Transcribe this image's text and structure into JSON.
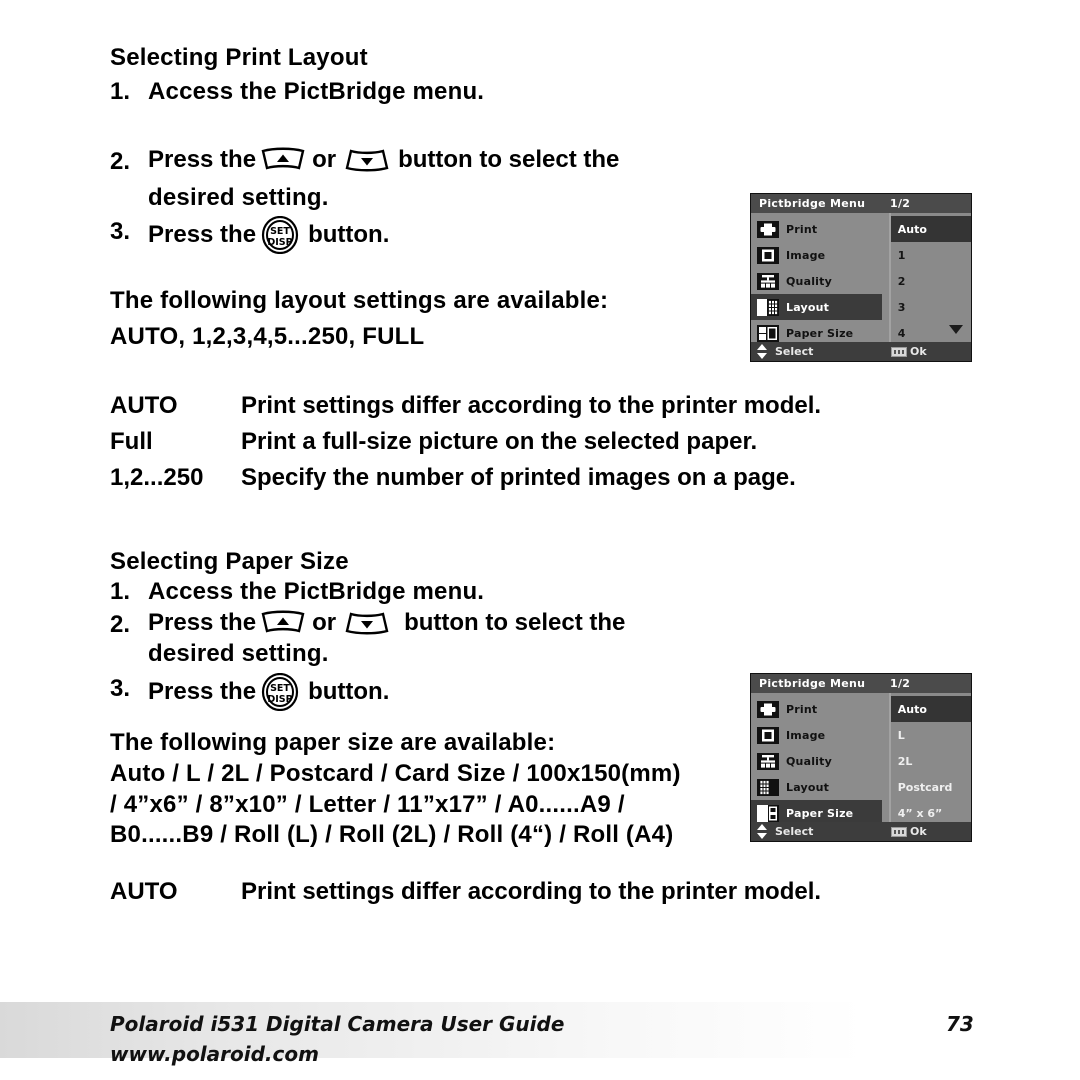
{
  "document": {
    "page_number": "73",
    "footer_title": "Polaroid i531 Digital Camera User Guide",
    "footer_url": "www.polaroid.com"
  },
  "section_layout": {
    "heading": "Selecting Print Layout",
    "steps": [
      {
        "number": "1.",
        "text": "Access the PictBridge menu."
      },
      {
        "number": "2.",
        "pre": "Press the",
        "mid": "or",
        "post": "button to select the",
        "cont": "desired setting."
      },
      {
        "number": "3.",
        "pre": "Press the",
        "post": "button."
      }
    ],
    "available_intro": "The following layout settings are available:",
    "available_values": "AUTO, 1,2,3,4,5...250, FULL",
    "definitions": [
      {
        "term": "AUTO",
        "desc": "Print settings differ according to the printer model."
      },
      {
        "term": "Full",
        "desc": "Print a full-size picture on the selected paper."
      },
      {
        "term": "1,2...250",
        "desc": "Specify the number of printed images on a page."
      }
    ]
  },
  "section_paper": {
    "heading": "Selecting Paper Size",
    "steps": [
      {
        "number": "1.",
        "text": "Access the PictBridge menu."
      },
      {
        "number": "2.",
        "pre": "Press the",
        "mid": "or",
        "post": "button to select the",
        "cont": "desired setting."
      },
      {
        "number": "3.",
        "pre": "Press the",
        "post": "button."
      }
    ],
    "available_intro": "The following paper size are available:",
    "available_line1": "Auto / L / 2L / Postcard / Card Size / 100x150(mm)",
    "available_line2": "/ 4”x6” / 8”x10” / Letter / 11”x17” / A0......A9 /",
    "available_line3": "B0......B9 / Roll (L) / Roll (2L) / Roll (4“) / Roll (A4)",
    "definitions": [
      {
        "term": "AUTO",
        "desc": "Print settings differ according to the printer model."
      }
    ]
  },
  "button_glyphs": {
    "up_arrow": "up-arrow-button",
    "down_arrow": "down-arrow-button",
    "set_disp_line1": "SET",
    "set_disp_line2": "DISP"
  },
  "lcd_layout": {
    "title": "Pictbridge Menu",
    "page_indicator": "1/2",
    "menu_items": [
      {
        "label": "Print",
        "icon": "printer-icon",
        "selected": false
      },
      {
        "label": "Image",
        "icon": "image-icon",
        "selected": false
      },
      {
        "label": "Quality",
        "icon": "quality-icon",
        "selected": false
      },
      {
        "label": "Layout",
        "icon": "layout-icon",
        "selected": true
      },
      {
        "label": "Paper Size",
        "icon": "paper-size-icon",
        "selected": false
      }
    ],
    "values": [
      {
        "label": "Auto",
        "selected": true
      },
      {
        "label": "1",
        "selected": false
      },
      {
        "label": "2",
        "selected": false
      },
      {
        "label": "3",
        "selected": false
      },
      {
        "label": "4",
        "selected": false
      }
    ],
    "value_text_style": "dark",
    "has_scroll_down": true,
    "status_select": "Select",
    "status_ok": "Ok"
  },
  "lcd_paper": {
    "title": "Pictbridge Menu",
    "page_indicator": "1/2",
    "menu_items": [
      {
        "label": "Print",
        "icon": "printer-icon",
        "selected": false
      },
      {
        "label": "Image",
        "icon": "image-icon",
        "selected": false
      },
      {
        "label": "Quality",
        "icon": "quality-icon",
        "selected": false
      },
      {
        "label": "Layout",
        "icon": "layout-icon",
        "selected": false
      },
      {
        "label": "Paper Size",
        "icon": "paper-size-icon",
        "selected": true
      }
    ],
    "values": [
      {
        "label": "Auto",
        "selected": true
      },
      {
        "label": "L",
        "selected": false
      },
      {
        "label": "2L",
        "selected": false
      },
      {
        "label": "Postcard",
        "selected": false
      },
      {
        "label": "4” x 6”",
        "selected": false
      }
    ],
    "value_text_style": "light",
    "has_scroll_down": false,
    "status_select": "Select",
    "status_ok": "Ok"
  },
  "colors": {
    "lcd_background": "#8c8c8c",
    "lcd_titlebar": "#4b4b4b",
    "lcd_selection": "#3b3b3b",
    "lcd_status": "#3d3d3d",
    "text": "#000000"
  }
}
